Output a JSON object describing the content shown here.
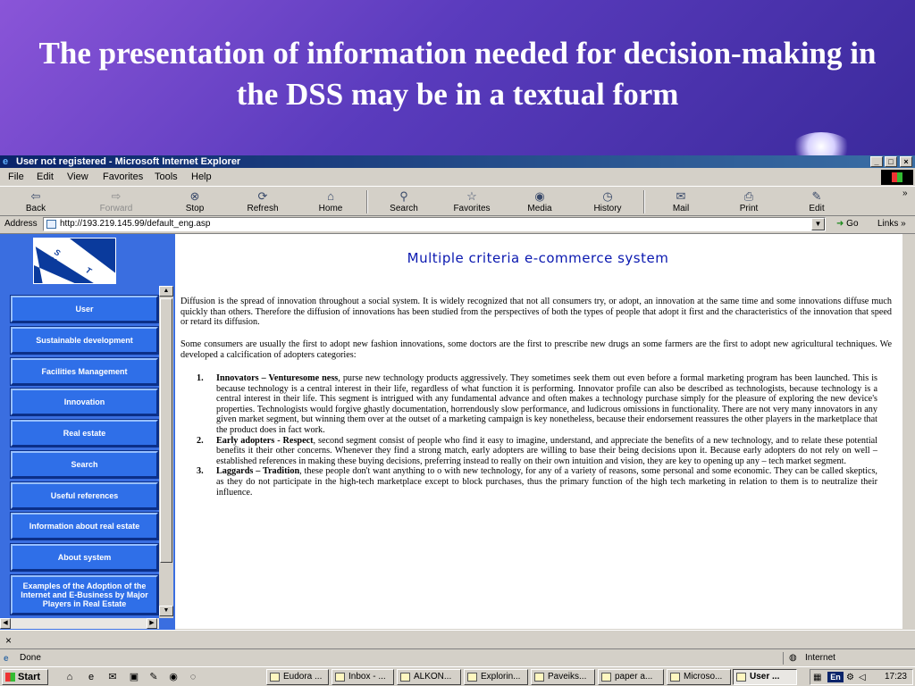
{
  "slide": {
    "title": "The presentation of information needed for decision-making in the DSS may be in a textual form"
  },
  "window": {
    "title": "User not registered - Microsoft Internet Explorer",
    "controls": [
      "_",
      "□",
      "×"
    ]
  },
  "menubar": {
    "items": [
      "File",
      "Edit",
      "View",
      "Favorites",
      "Tools",
      "Help"
    ]
  },
  "toolbar": {
    "buttons": [
      {
        "label": "Back",
        "icon": "back-arrow-icon"
      },
      {
        "label": "Forward",
        "icon": "forward-arrow-icon"
      },
      {
        "label": "Stop",
        "icon": "stop-icon"
      },
      {
        "label": "Refresh",
        "icon": "refresh-icon"
      },
      {
        "label": "Home",
        "icon": "home-icon"
      },
      {
        "label": "Search",
        "icon": "search-icon"
      },
      {
        "label": "Favorites",
        "icon": "favorites-icon"
      },
      {
        "label": "Media",
        "icon": "media-icon"
      },
      {
        "label": "History",
        "icon": "history-icon"
      },
      {
        "label": "Mail",
        "icon": "mail-icon"
      },
      {
        "label": "Print",
        "icon": "print-icon"
      },
      {
        "label": "Edit",
        "icon": "edit-icon"
      }
    ],
    "more": "»"
  },
  "addressbar": {
    "label": "Address",
    "url": "http://193.219.145.99/default_eng.asp",
    "go_label": "Go",
    "links_label": "Links »"
  },
  "sidebar": {
    "logo_text": "S T V",
    "items": [
      "User",
      "Sustainable development",
      "Facilities Management",
      "Innovation",
      "Real estate",
      "Search",
      "Useful references",
      "Information about real estate",
      "About system",
      "Examples of the Adoption of the Internet and E-Business by Major Players in Real Estate"
    ]
  },
  "page": {
    "heading": "Multiple criteria e-commerce system",
    "paragraph1": "Diffusion is the spread of innovation throughout a social system. It is widely recognized that not all consumers try, or adopt, an innovation at the same time and some innovations diffuse much quickly than others. Therefore the diffusion of innovations has been studied from the perspectives of both the types of people that adopt it first and the characteristics of the innovation that speed or retard its diffusion.",
    "paragraph2": "Some consumers are usually the first to adopt new fashion innovations, some doctors are the first to prescribe new drugs an some farmers are the first to adopt new agricultural techniques. We developed a calcification of adopters categories:",
    "adopters": [
      {
        "num": "1.",
        "term": "Innovators – Venturesome ness",
        "text": ", purse new technology products aggressively. They sometimes seek them out even before a formal marketing program has been launched. This is because technology is a central interest in their life, regardless of what function it is performing. Innovator profile can also be described as technologists, because technology is a central interest in their life. This segment is intrigued with any fundamental advance and often makes a technology purchase simply for the pleasure of exploring the new device's properties. Technologists would forgive ghastly documentation, horrendously slow performance, and ludicrous omissions in functionality. There are not very many innovators in any given market segment, but winning them over at the outset of a marketing campaign is key nonetheless, because their endorsement reassures the other players in the marketplace that the product does in fact work."
      },
      {
        "num": "2.",
        "term": "Early adopters - Respect",
        "text": ", second segment consist of people who find it easy to imagine, understand, and appreciate the benefits of a new technology, and to relate these potential benefits it their other concerns. Whenever they find a strong match, early adopters are willing to base their being decisions upon it. Because early adopters do not rely on well – established references in making these buying decisions, preferring instead to really on their own intuition and vision, they are key to opening up any – tech market segment."
      },
      {
        "num": "3.",
        "term": "Laggards – Tradition",
        "text": ", these people don't want anything to o with new technology, for any of a variety of reasons, some personal and some economic. They can be called skeptics, as they do not participate in the high-tech marketplace except to block purchases, thus the primary function of the high tech marketing in relation to them is to neutralize their influence."
      }
    ]
  },
  "statusbar": {
    "close_glyph": "×",
    "status": "Done",
    "zone": "Internet"
  },
  "taskbar": {
    "start_label": "Start",
    "tasks": [
      "Eudora ...",
      "Inbox - ...",
      "ALKON...",
      "Explorin...",
      "Paveiks...",
      "paper a...",
      "Microso...",
      "User ..."
    ],
    "active_task": 7,
    "lang": "En",
    "clock": "17:23"
  },
  "colors": {
    "slide_bg": "#5a3bbd",
    "sidebar_bg": "#3a6ee0",
    "nav_button": "#2f6fe8",
    "heading_blue": "#0a18b0",
    "titlebar": "#0a246a"
  }
}
